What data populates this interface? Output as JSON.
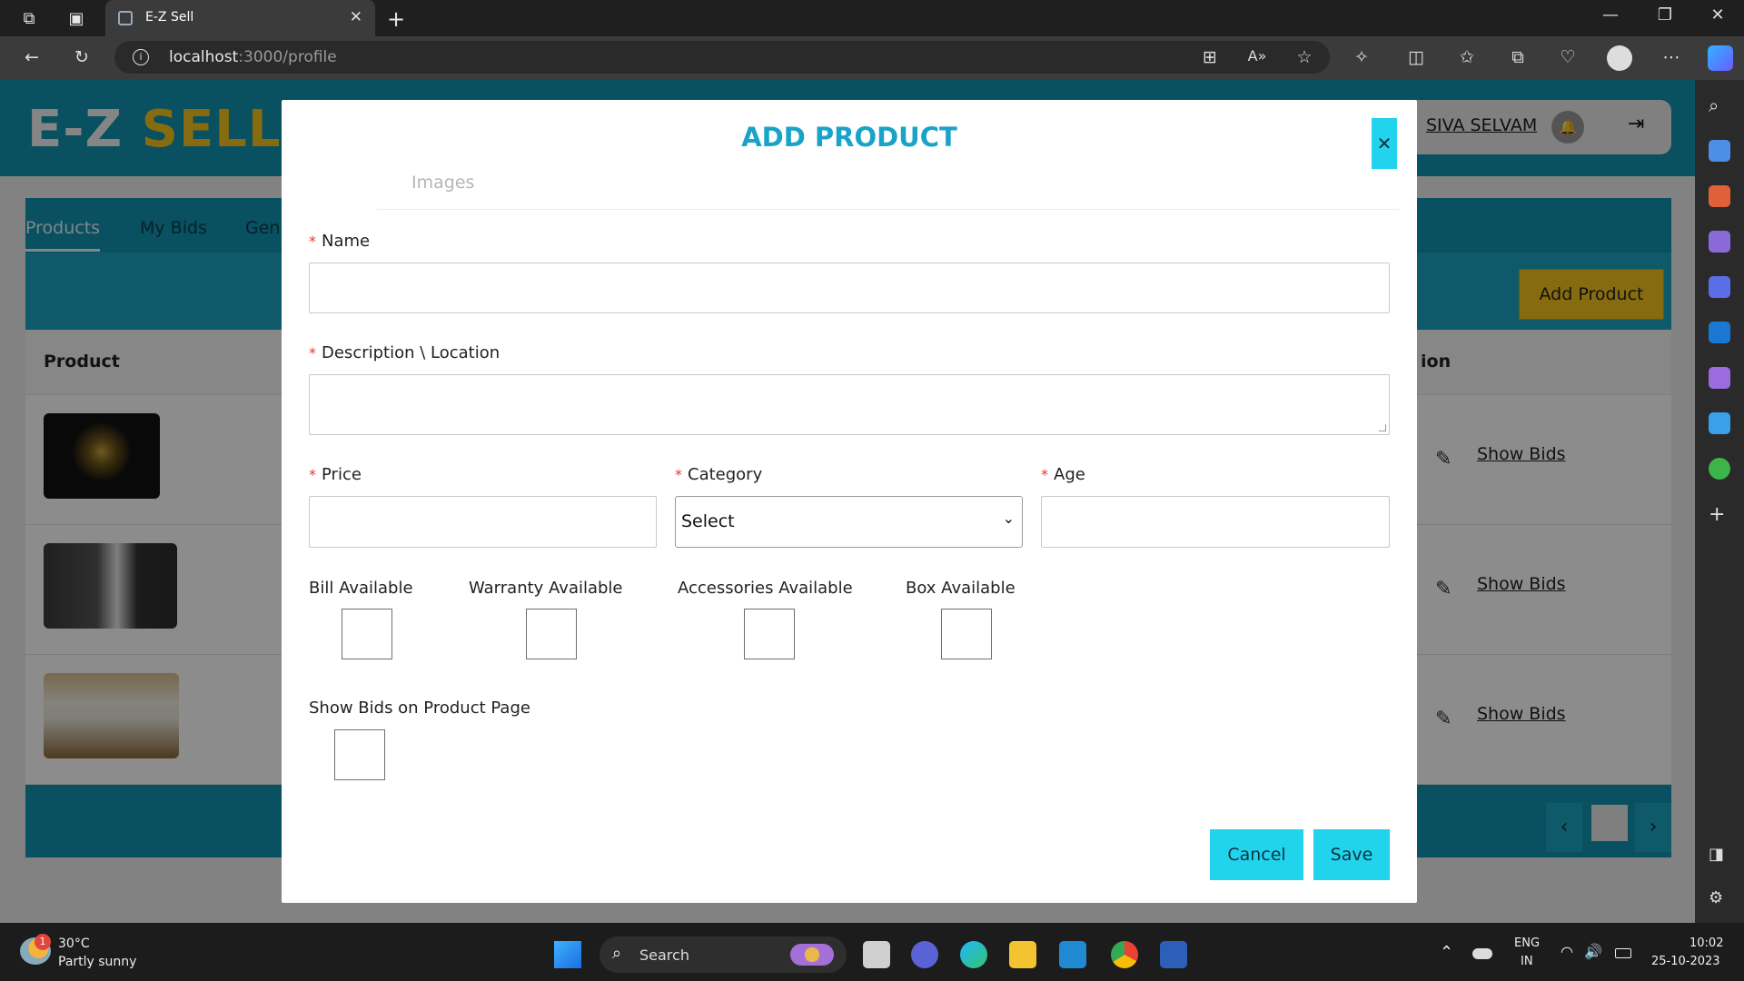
{
  "browser": {
    "tab_title": "E-Z Sell",
    "url_host": "localhost",
    "url_path": ":3000/profile"
  },
  "app": {
    "logo_part1": "E-Z",
    "logo_part2": "SELL",
    "user_name": "SIVA SELVAM",
    "tabs": [
      {
        "label": "Products",
        "active": true
      },
      {
        "label": "My Bids",
        "active": false
      },
      {
        "label": "Gen",
        "active": false
      }
    ],
    "add_product_button": "Add Product",
    "table_header_product": "Product",
    "table_header_action": "ion",
    "rows": [
      {
        "image": "cross-pendant-image",
        "action_label": "Show Bids"
      },
      {
        "image": "game-console-image",
        "action_label": "Show Bids"
      },
      {
        "image": "air-conditioner-image",
        "action_label": "Show Bids"
      }
    ],
    "prev_icon": "‹",
    "next_icon": "›"
  },
  "modal": {
    "title": "ADD PRODUCT",
    "tab_images": "Images",
    "fields": {
      "name_label": "Name",
      "description_label": "Description \\ Location",
      "price_label": "Price",
      "category_label": "Category",
      "category_value": "Select",
      "age_label": "Age",
      "bill_label": "Bill Available",
      "warranty_label": "Warranty Available",
      "accessories_label": "Accessories Available",
      "box_label": "Box Available",
      "showbids_label": "Show Bids on Product Page"
    },
    "cancel_button": "Cancel",
    "save_button": "Save"
  },
  "taskbar": {
    "weather_temp": "30°C",
    "weather_desc": "Partly sunny",
    "weather_badge": "1",
    "search_label": "Search",
    "lang_line1": "ENG",
    "lang_line2": "IN",
    "time": "10:02",
    "date": "25-10-2023"
  },
  "colors": {
    "accent": "#1293b0",
    "brand_yellow": "#f4c31c",
    "modal_button": "#22d3ee",
    "required_star": "#ee3333"
  }
}
